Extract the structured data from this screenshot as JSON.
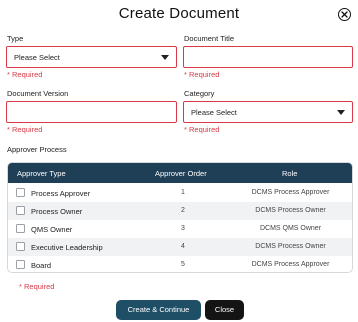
{
  "dialog": {
    "title": "Create Document"
  },
  "form": {
    "type": {
      "label": "Type",
      "value": "Please Select",
      "required_text": "* Required"
    },
    "document_title": {
      "label": "Document Title",
      "value": "",
      "required_text": "* Required"
    },
    "document_version": {
      "label": "Document Version",
      "value": "",
      "required_text": "* Required"
    },
    "category": {
      "label": "Category",
      "value": "Please Select",
      "required_text": "* Required"
    }
  },
  "approver_process": {
    "label": "Approver Process",
    "columns": [
      "Approver Type",
      "Approver Order",
      "Role"
    ],
    "rows": [
      {
        "type": "Process Approver",
        "order": "1",
        "role": "DCMS Process Approver",
        "checked": false
      },
      {
        "type": "Process Owner",
        "order": "2",
        "role": "DCMS Process Owner",
        "checked": false
      },
      {
        "type": "QMS Owner",
        "order": "3",
        "role": "DCMS QMS Owner",
        "checked": false
      },
      {
        "type": "Executive Leadership",
        "order": "4",
        "role": "DCMS Process Owner",
        "checked": false
      },
      {
        "type": "Board",
        "order": "5",
        "role": "DCMS Process Approver",
        "checked": false
      }
    ],
    "required_text": "* Required"
  },
  "actions": {
    "create_label": "Create & Continue",
    "close_label": "Close"
  },
  "colors": {
    "error_red": "#d63c48",
    "table_header": "#1f3f57",
    "primary_button": "#1f4f67",
    "dark_button": "#141414"
  },
  "icons": {
    "close": "close-circle-icon",
    "dropdown": "chevron-down-icon"
  }
}
